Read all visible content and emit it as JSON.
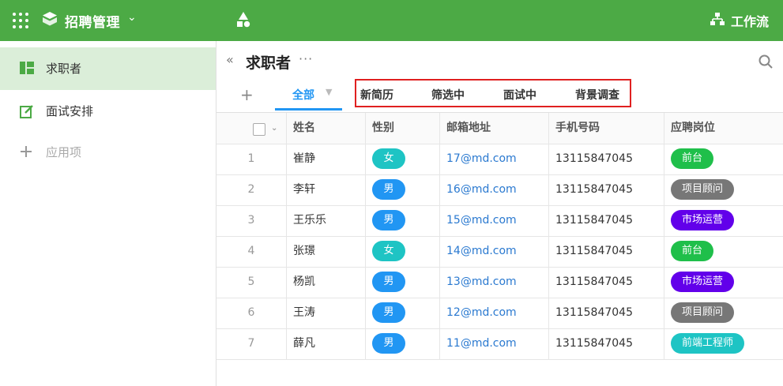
{
  "app": {
    "title": "招聘管理",
    "workflow_label": "工作流",
    "brand_color": "#4caa45"
  },
  "sidebar": {
    "items": [
      {
        "label": "求职者",
        "icon": "table-view-icon",
        "active": true
      },
      {
        "label": "面试安排",
        "icon": "edit-note-icon",
        "active": false
      },
      {
        "label": "应用项",
        "icon": "plus-icon",
        "active": false
      }
    ]
  },
  "main": {
    "title": "求职者",
    "more_label": "···",
    "tabs": [
      {
        "label": "全部",
        "active": true
      },
      {
        "label": "新简历"
      },
      {
        "label": "筛选中"
      },
      {
        "label": "面试中"
      },
      {
        "label": "背景调查"
      }
    ]
  },
  "table": {
    "columns": [
      "姓名",
      "性别",
      "邮箱地址",
      "手机号码",
      "应聘岗位"
    ],
    "rows": [
      {
        "no": "1",
        "name": "崔静",
        "gender": "女",
        "email": "17@md.com",
        "phone": "13115847045",
        "position": "前台"
      },
      {
        "no": "2",
        "name": "李轩",
        "gender": "男",
        "email": "16@md.com",
        "phone": "13115847045",
        "position": "项目顾问"
      },
      {
        "no": "3",
        "name": "王乐乐",
        "gender": "男",
        "email": "15@md.com",
        "phone": "13115847045",
        "position": "市场运营"
      },
      {
        "no": "4",
        "name": "张璟",
        "gender": "女",
        "email": "14@md.com",
        "phone": "13115847045",
        "position": "前台"
      },
      {
        "no": "5",
        "name": "杨凯",
        "gender": "男",
        "email": "13@md.com",
        "phone": "13115847045",
        "position": "市场运营"
      },
      {
        "no": "6",
        "name": "王涛",
        "gender": "男",
        "email": "12@md.com",
        "phone": "13115847045",
        "position": "项目顾问"
      },
      {
        "no": "7",
        "name": "薛凡",
        "gender": "男",
        "email": "11@md.com",
        "phone": "13115847045",
        "position": "前端工程师"
      }
    ]
  },
  "colors": {
    "gender_female": "#1ec4c4",
    "gender_male": "#2196f3",
    "pos_前台": "#1fbf4a",
    "pos_项目顾问": "#777777",
    "pos_市场运营": "#6200ea",
    "pos_前端工程师": "#1ec4c4",
    "accent": "#2196f3",
    "highlight_box": "#e02020"
  }
}
